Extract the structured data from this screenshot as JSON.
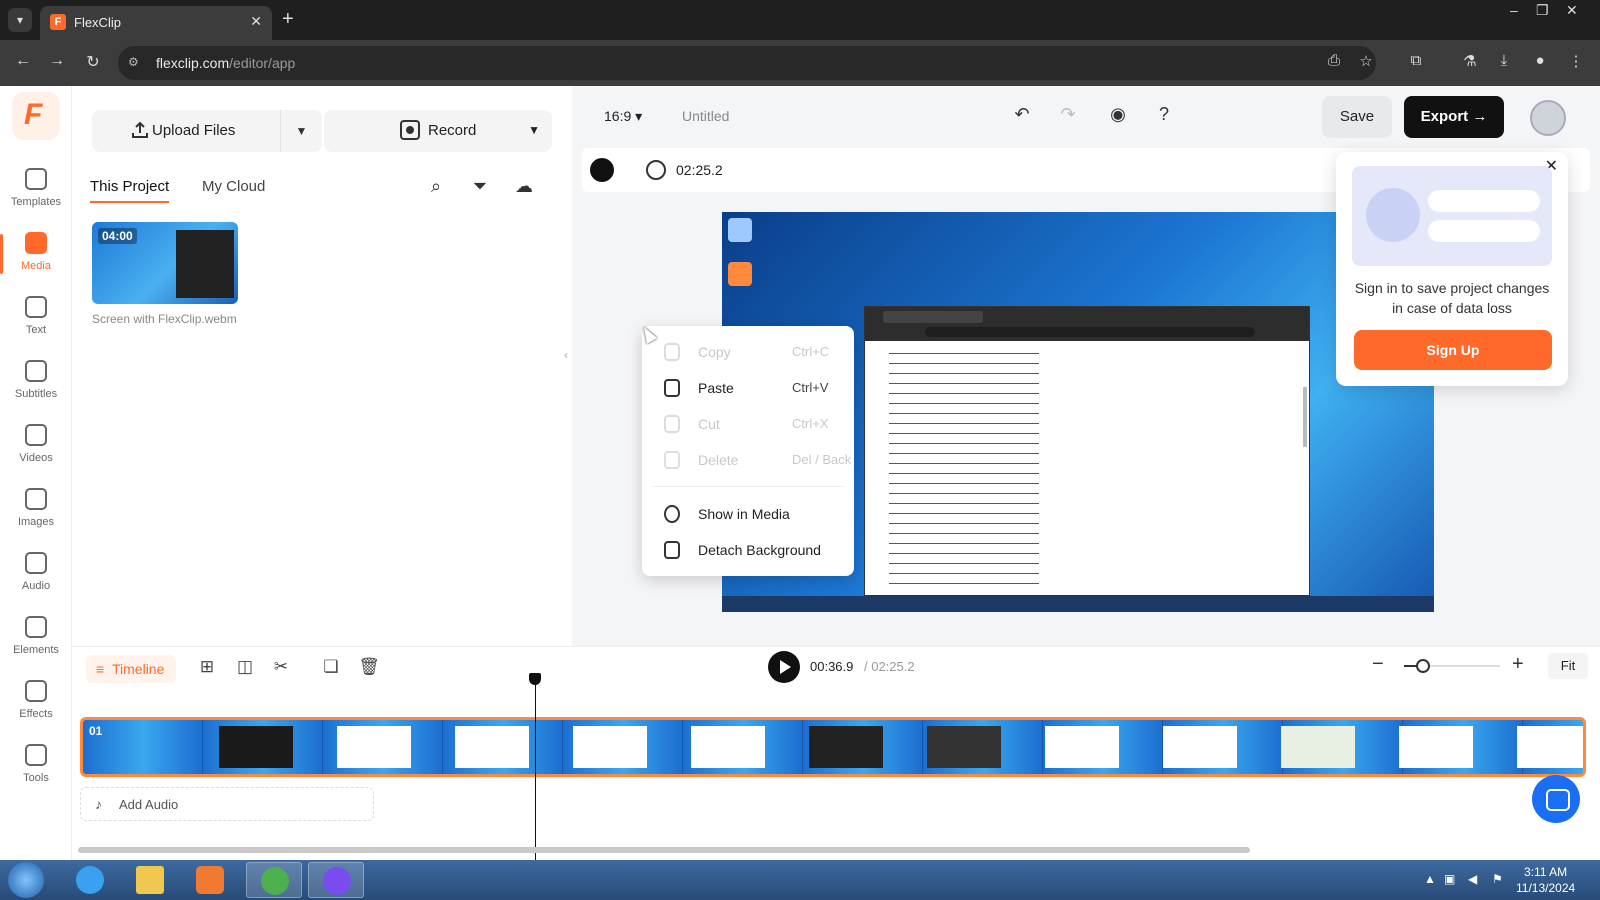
{
  "browser": {
    "tab_title": "FlexClip",
    "url_host": "flexclip.com",
    "url_path": "/editor/app"
  },
  "rail": {
    "items": [
      {
        "label": "Templates",
        "icon": "templates-icon"
      },
      {
        "label": "Media",
        "icon": "media-icon",
        "active": true
      },
      {
        "label": "Text",
        "icon": "text-icon"
      },
      {
        "label": "Subtitles",
        "icon": "subtitles-icon"
      },
      {
        "label": "Videos",
        "icon": "videos-icon"
      },
      {
        "label": "Images",
        "icon": "images-icon"
      },
      {
        "label": "Audio",
        "icon": "audio-icon"
      },
      {
        "label": "Elements",
        "icon": "elements-icon"
      },
      {
        "label": "Effects",
        "icon": "effects-icon"
      },
      {
        "label": "Tools",
        "icon": "tools-icon"
      }
    ]
  },
  "media_panel": {
    "upload_label": "Upload Files",
    "record_label": "Record",
    "tabs": [
      "This Project",
      "My Cloud"
    ],
    "asset": {
      "duration": "04:00",
      "name": "Screen with FlexClip.webm"
    }
  },
  "editor": {
    "aspect_ratio": "16:9",
    "project_title": "Untitled",
    "save_label": "Save",
    "export_label": "Export",
    "duration": "02:25.2"
  },
  "context_menu": {
    "items": [
      {
        "label": "Copy",
        "shortcut": "Ctrl+C",
        "enabled": false
      },
      {
        "label": "Paste",
        "shortcut": "Ctrl+V",
        "enabled": true
      },
      {
        "label": "Cut",
        "shortcut": "Ctrl+X",
        "enabled": false
      },
      {
        "label": "Delete",
        "shortcut": "Del / Back",
        "enabled": false
      },
      {
        "label": "Show in Media",
        "shortcut": "",
        "enabled": true
      },
      {
        "label": "Detach Background",
        "shortcut": "",
        "enabled": true
      }
    ]
  },
  "signin_popover": {
    "message": "Sign in to save project changes in case of data loss",
    "button_label": "Sign Up"
  },
  "timeline": {
    "badge_label": "Timeline",
    "current_time": "00:36.9",
    "total_time": "/ 02:25.2",
    "fit_label": "Fit",
    "track_number": "01",
    "add_audio_label": "Add Audio",
    "zoom_level": 0.2
  },
  "taskbar": {
    "time": "3:11 AM",
    "date": "11/13/2024"
  },
  "colors": {
    "brand": "#ff6a2b",
    "export_bg": "#111111",
    "chat_fab": "#1a6ef5"
  }
}
